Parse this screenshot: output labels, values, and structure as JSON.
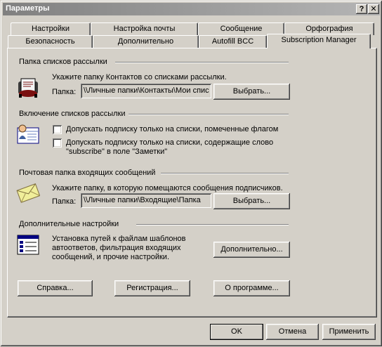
{
  "window": {
    "title": "Параметры",
    "help_glyph": "?",
    "close_glyph": "✕"
  },
  "tabs_back": [
    "Настройки",
    "Настройка почты",
    "Сообщение",
    "Орфография"
  ],
  "tabs_front": [
    "Безопасность",
    "Дополнительно",
    "Autofill BCC",
    "Subscription Manager"
  ],
  "sections": {
    "folders": {
      "header": "Папка списков рассылки",
      "prompt": "Укажите папку Контактов со списками рассылки.",
      "field_label": "Папка:",
      "field_value": "\\\\Личные папки\\Контакты\\Мои спис",
      "browse": "Выбрать..."
    },
    "enable": {
      "header": "Включение списков рассылки",
      "option1": "Допускать подписку только на списки, помеченные флагом",
      "option2_line1": "Допускать подписку только на списки, содержащие слово",
      "option2_line2": "\"subscribe\" в поле \"Заметки\""
    },
    "inbox": {
      "header": "Почтовая папка входящих сообщений",
      "prompt": "Укажите папку, в которую помещаются сообщения подписчиков.",
      "field_label": "Папка:",
      "field_value": "\\\\Личные папки\\Входящие\\Папка",
      "browse": "Выбрать..."
    },
    "advanced": {
      "header": "Дополнительные настройки",
      "desc_line1": "Установка путей к файлам шаблонов",
      "desc_line2": "автоответов, фильтрация входящих",
      "desc_line3": "сообщений, и прочие настройки.",
      "button": "Дополнительно..."
    }
  },
  "bottom_buttons": {
    "help": "Справка...",
    "register": "Регистрация...",
    "about": "О программе..."
  },
  "dialog_buttons": {
    "ok": "OK",
    "cancel": "Отмена",
    "apply": "Применить"
  }
}
